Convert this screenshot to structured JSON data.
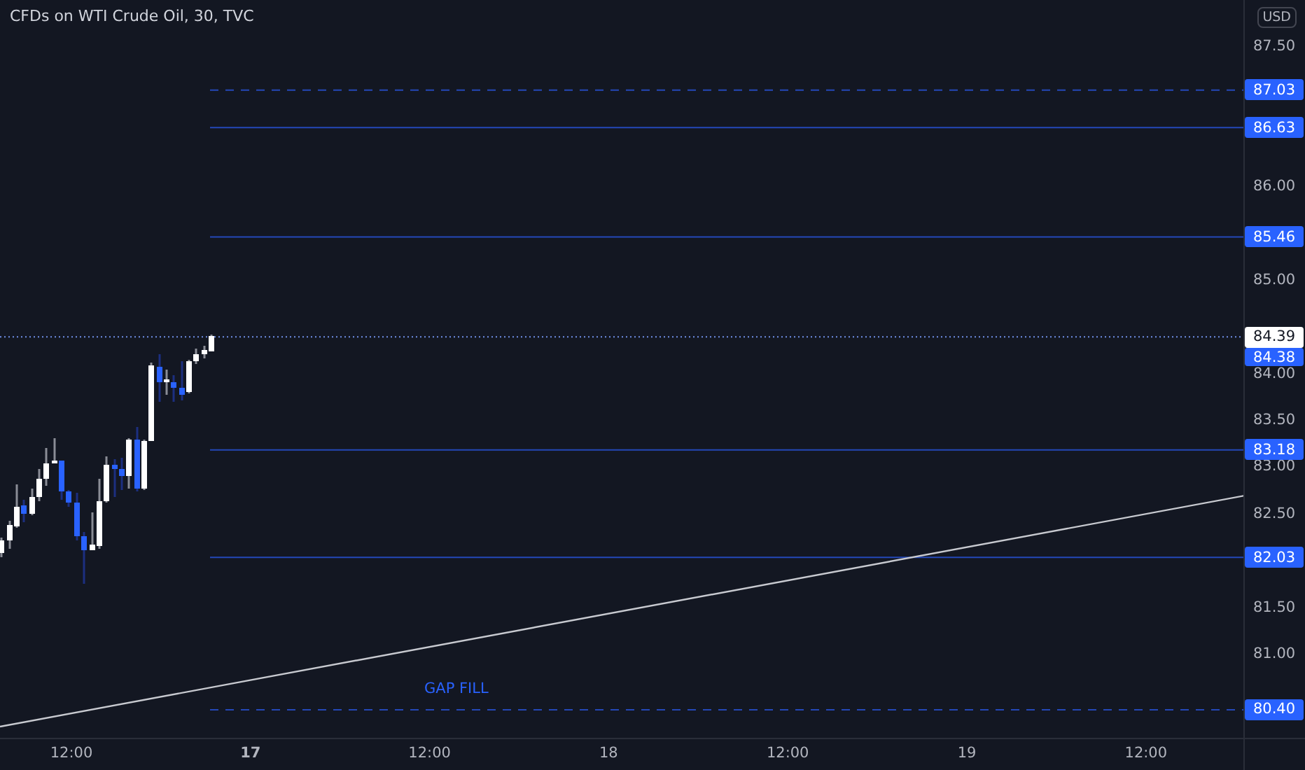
{
  "title": "CFDs on WTI Crude Oil, 30, TVC",
  "currency": "USD",
  "price_axis_ticks": [
    "87.50",
    "86.00",
    "85.00",
    "84.00",
    "83.50",
    "83.00",
    "82.50",
    "81.50",
    "81.00"
  ],
  "levels": [
    {
      "label": "87.03",
      "kind": "dashed"
    },
    {
      "label": "86.63",
      "kind": "solid"
    },
    {
      "label": "85.46",
      "kind": "solid"
    },
    {
      "label": "83.18",
      "kind": "solid"
    },
    {
      "label": "82.03",
      "kind": "solid"
    },
    {
      "label": "80.40",
      "kind": "dashed"
    }
  ],
  "markers": [
    {
      "label": "84.39",
      "kind": "last"
    },
    {
      "label": "84.38",
      "kind": "previous"
    }
  ],
  "annotation": "GAP FILL",
  "time_axis": [
    {
      "label": "12:00",
      "bold": false
    },
    {
      "label": "17",
      "bold": true
    },
    {
      "label": "12:00",
      "bold": false
    },
    {
      "label": "18",
      "bold": false
    },
    {
      "label": "12:00",
      "bold": false
    },
    {
      "label": "19",
      "bold": false
    },
    {
      "label": "12:00",
      "bold": false
    }
  ]
}
